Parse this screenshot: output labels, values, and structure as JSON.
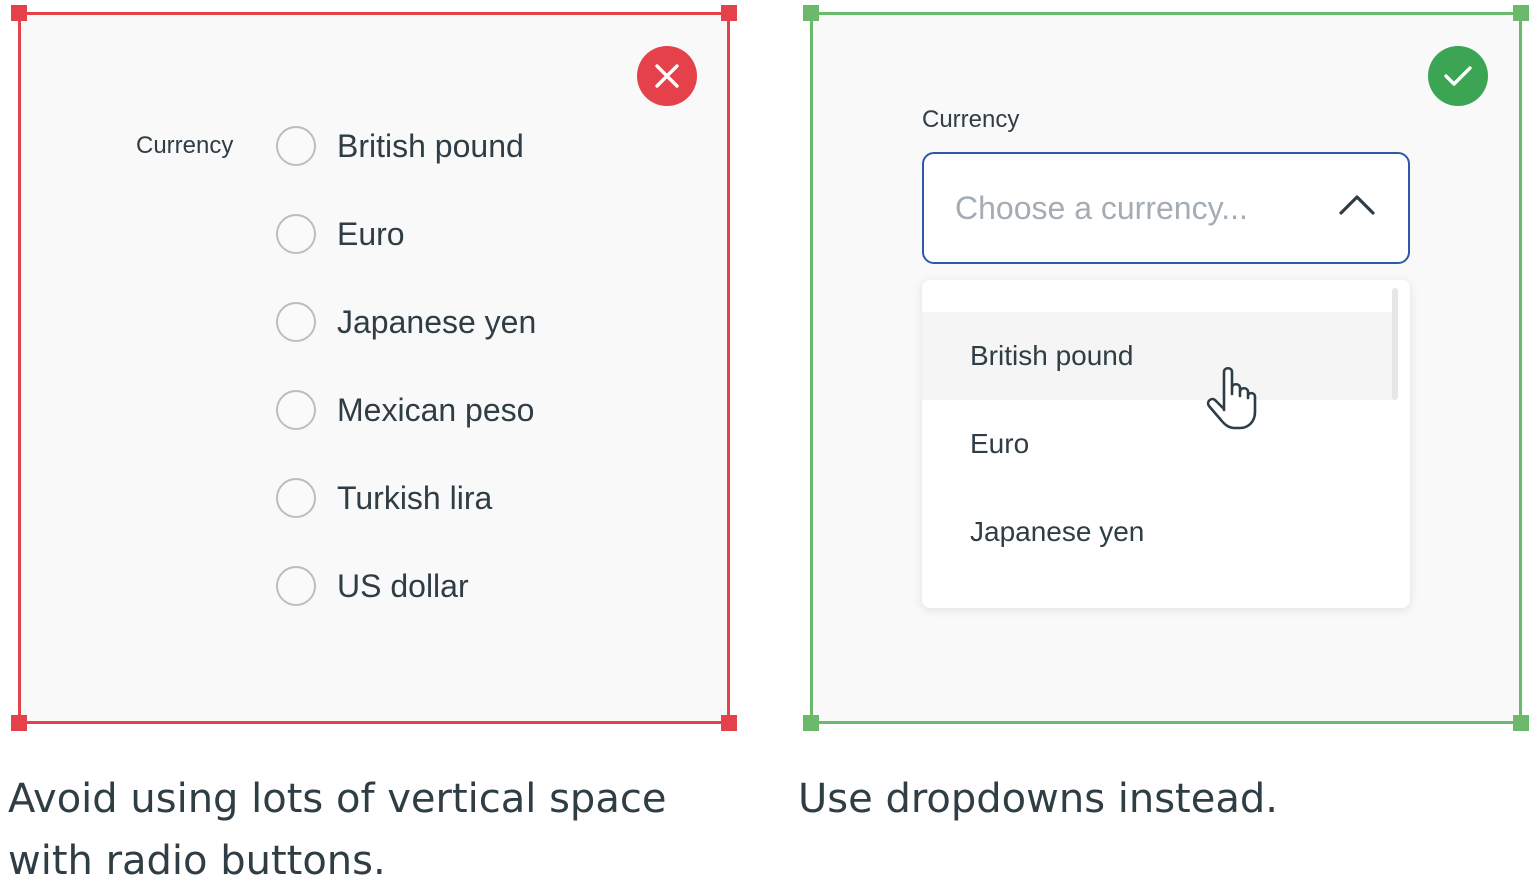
{
  "colors": {
    "bad_accent": "#e5414b",
    "good_accent": "#3ba553",
    "select_border": "#2d5aa8"
  },
  "bad_example": {
    "icon": "close-icon",
    "field_label": "Currency",
    "options": [
      "British pound",
      "Euro",
      "Japanese yen",
      "Mexican peso",
      "Turkish lira",
      "US dollar"
    ],
    "caption": "Avoid using lots of vertical space with radio buttons."
  },
  "good_example": {
    "icon": "check-icon",
    "field_label": "Currency",
    "placeholder": "Choose a currency...",
    "chevron_icon": "chevron-up-icon",
    "options": [
      "British pound",
      "Euro",
      "Japanese yen"
    ],
    "hovered_option": "British pound",
    "cursor_icon": "hand-pointer-icon",
    "caption": "Use dropdowns instead."
  }
}
